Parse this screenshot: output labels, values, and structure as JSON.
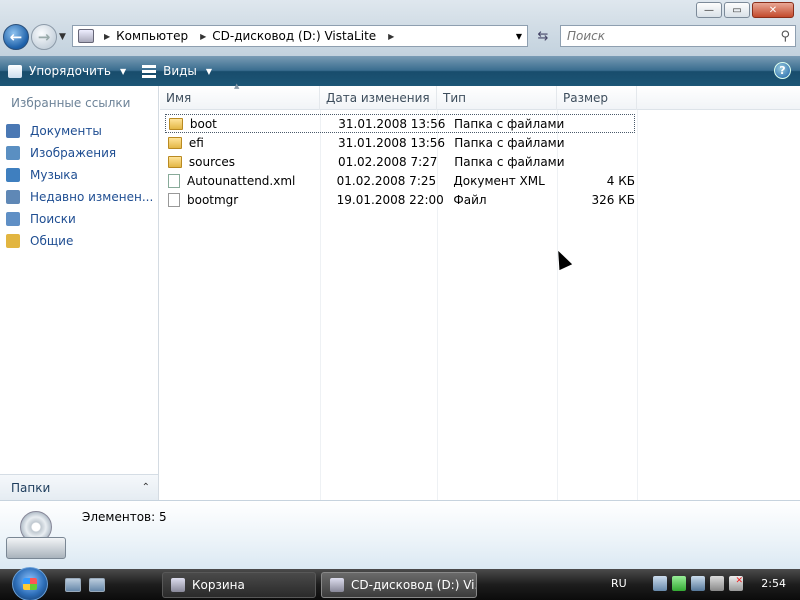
{
  "window": {
    "buttons": {
      "minimize": "—",
      "maximize": "▭",
      "close": "✕"
    }
  },
  "address": {
    "segments": [
      "Компьютер",
      "CD-дисковод (D:) VistaLite"
    ]
  },
  "search": {
    "placeholder": "Поиск"
  },
  "toolbar": {
    "organize": "Упорядочить",
    "views": "Виды",
    "help": "?"
  },
  "nav": {
    "title": "Избранные ссылки",
    "items": [
      {
        "label": "Документы",
        "color": "#4a78b4"
      },
      {
        "label": "Изображения",
        "color": "#5a8fc2"
      },
      {
        "label": "Музыка",
        "color": "#3f7fbf"
      },
      {
        "label": "Недавно изменен...",
        "color": "#5f88b6"
      },
      {
        "label": "Поиски",
        "color": "#5f8fc5"
      },
      {
        "label": "Общие",
        "color": "#e2b540"
      }
    ],
    "folders_label": "Папки"
  },
  "columns": {
    "name": "Имя",
    "date": "Дата изменения",
    "type": "Тип",
    "size": "Размер"
  },
  "files": [
    {
      "name": "boot",
      "date": "31.01.2008 13:56",
      "type": "Папка с файлами",
      "size": "",
      "icon": "folder"
    },
    {
      "name": "efi",
      "date": "31.01.2008 13:56",
      "type": "Папка с файлами",
      "size": "",
      "icon": "folder"
    },
    {
      "name": "sources",
      "date": "01.02.2008 7:27",
      "type": "Папка с файлами",
      "size": "",
      "icon": "folder"
    },
    {
      "name": "Autounattend.xml",
      "date": "01.02.2008 7:25",
      "type": "Документ XML",
      "size": "4 КБ",
      "icon": "xml"
    },
    {
      "name": "bootmgr",
      "date": "19.01.2008 22:00",
      "type": "Файл",
      "size": "326 КБ",
      "icon": "file"
    }
  ],
  "details": {
    "count": "Элементов: 5"
  },
  "taskbar": {
    "tasks": [
      "Корзина",
      "CD-дисковод (D:) Vi..."
    ],
    "lang": "RU",
    "clock": "2:54"
  }
}
